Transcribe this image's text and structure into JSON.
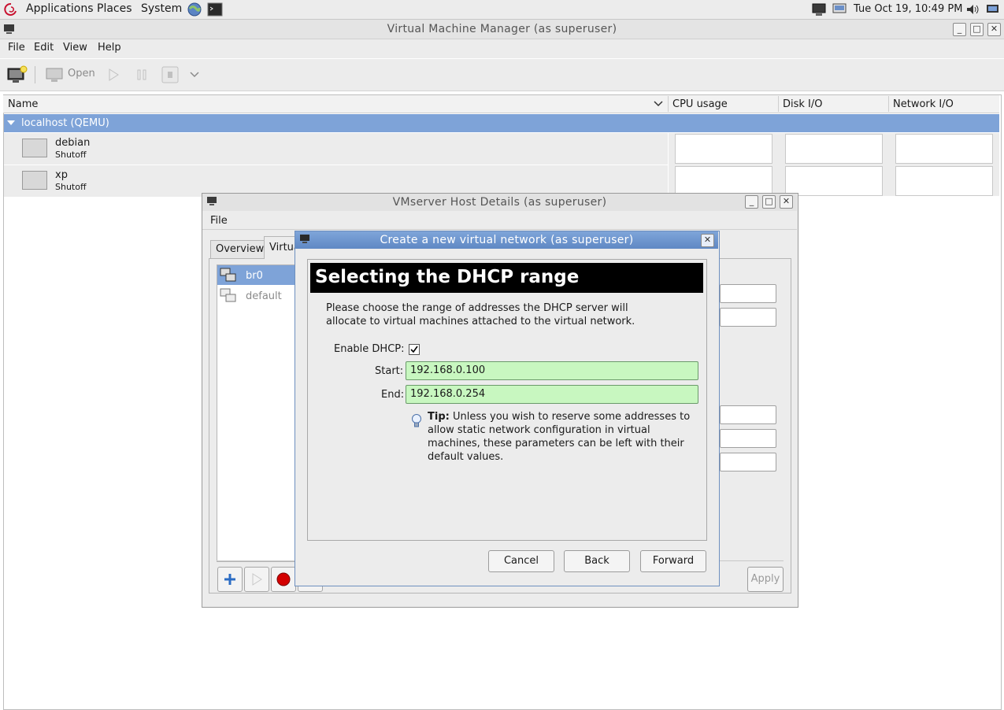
{
  "top_panel": {
    "menus": [
      "Applications",
      "Places",
      "System"
    ],
    "clock": "Tue Oct 19, 10:49 PM"
  },
  "main_window": {
    "title": "Virtual Machine Manager (as superuser)",
    "menus": [
      "File",
      "Edit",
      "View",
      "Help"
    ],
    "toolbar": {
      "open_label": "Open"
    },
    "columns": [
      "Name",
      "CPU usage",
      "Disk I/O",
      "Network I/O"
    ],
    "host": "localhost (QEMU)",
    "vms": [
      {
        "name": "debian",
        "status": "Shutoff"
      },
      {
        "name": "xp",
        "status": "Shutoff"
      }
    ]
  },
  "host_window": {
    "title": "VMserver Host Details (as superuser)",
    "menu_file": "File",
    "tabs": [
      "Overview",
      "Virtua"
    ],
    "networks": [
      "br0",
      "default"
    ],
    "apply_label": "Apply"
  },
  "dialog": {
    "title": "Create a new virtual network (as superuser)",
    "header": "Selecting the DHCP range",
    "description": "Please choose the range of addresses the DHCP server will allocate to virtual machines attached to the virtual network.",
    "enable_dhcp_label": "Enable DHCP:",
    "enable_dhcp_checked": true,
    "start_label": "Start:",
    "start_value": "192.168.0.100",
    "end_label": "End:",
    "end_value": "192.168.0.254",
    "tip_label": "Tip:",
    "tip_text": "Unless you wish to reserve some addresses to allow static network configuration in virtual machines, these parameters can be left with their default values.",
    "buttons": {
      "cancel": "Cancel",
      "back": "Back",
      "forward": "Forward"
    }
  }
}
